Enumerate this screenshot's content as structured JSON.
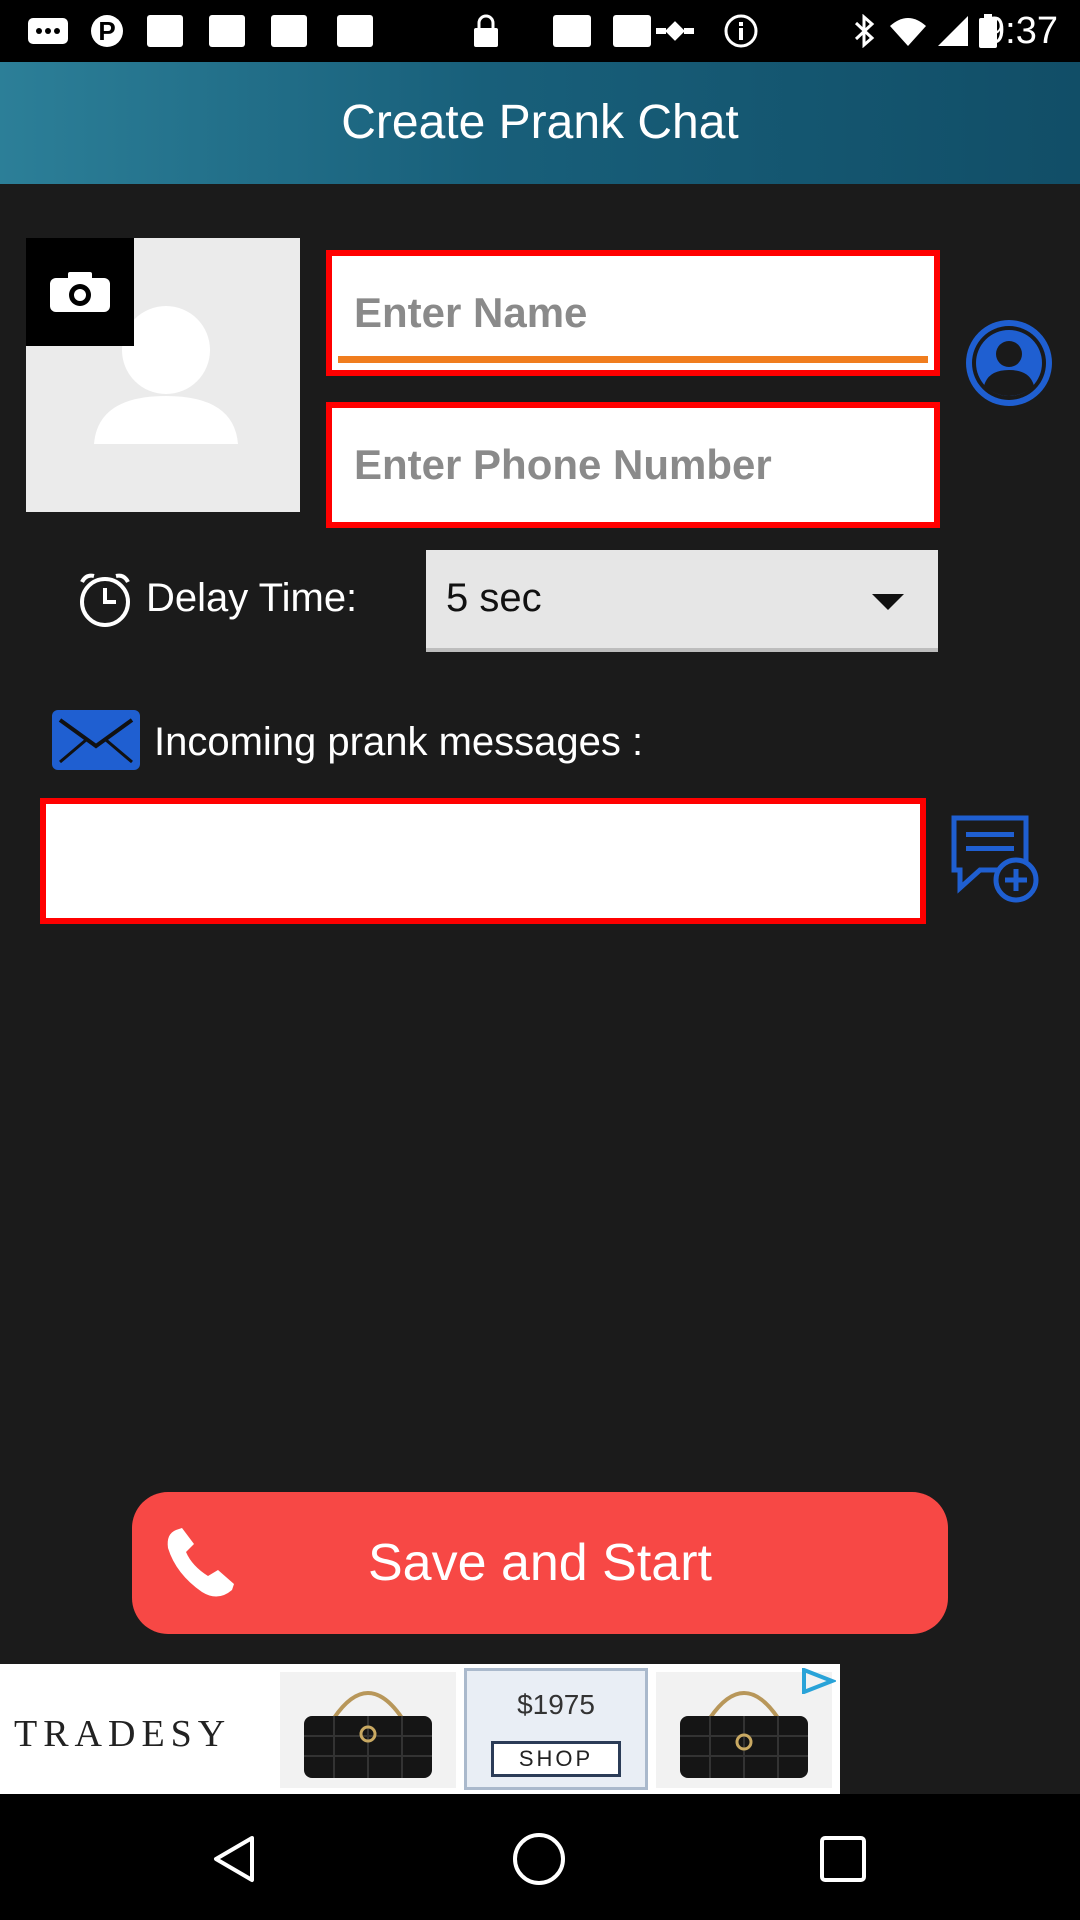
{
  "status_bar": {
    "time": "9:37",
    "icons": [
      "chat-icon",
      "pinterest-icon",
      "gallery-icon",
      "lock-icon",
      "gallery-icon",
      "satellite-icon",
      "info-icon",
      "bluetooth-icon",
      "wifi-icon",
      "signal-icon",
      "battery-icon"
    ]
  },
  "header": {
    "title": "Create Prank Chat"
  },
  "form": {
    "name_placeholder": "Enter Name",
    "phone_placeholder": "Enter Phone Number",
    "delay_label": "Delay Time:",
    "delay_value": "5 sec",
    "messages_label": "Incoming prank messages :",
    "message_value": ""
  },
  "save_button": {
    "label": "Save and Start"
  },
  "ad": {
    "brand": "TRADESY",
    "price": "$1975",
    "cta": "SHOP"
  },
  "colors": {
    "accent_red": "#f74845",
    "field_border": "#ff0000",
    "title_bar": "#1b6a86",
    "icon_blue": "#1f5fd1",
    "background": "#1b1b1b"
  }
}
